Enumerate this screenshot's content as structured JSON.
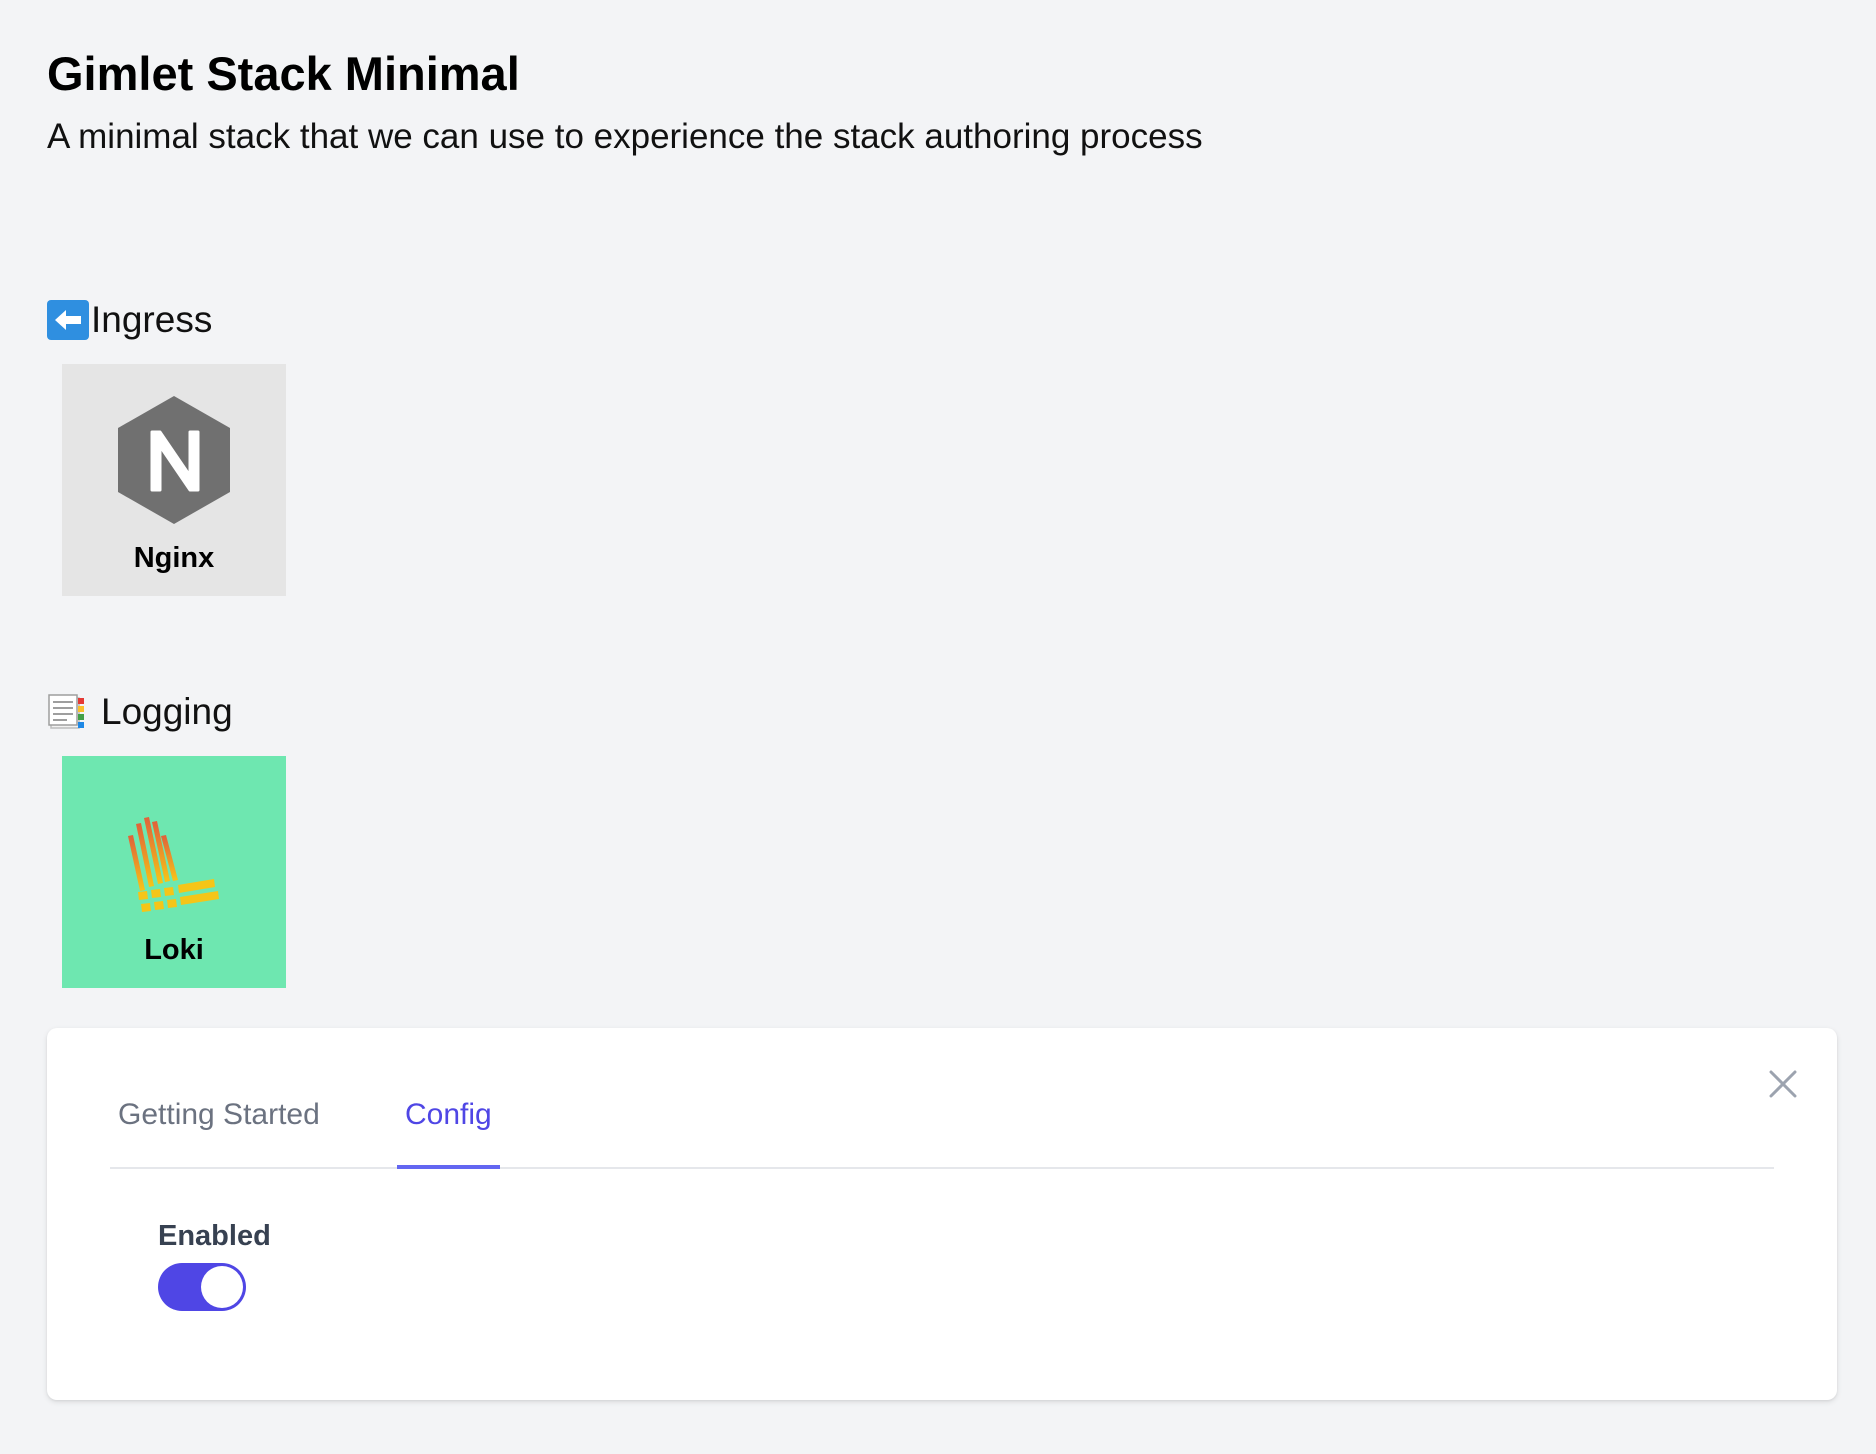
{
  "stack": {
    "title": "Gimlet Stack Minimal",
    "description": "A minimal stack that we can use to experience the stack authoring process"
  },
  "categories": [
    {
      "icon": "left-arrow-icon",
      "label": "Ingress",
      "components": [
        {
          "name": "Nginx",
          "logo": "nginx-logo",
          "tile_color": "#e5e5e5",
          "selected": false
        }
      ]
    },
    {
      "icon": "bookmark-tabs-icon",
      "label": "Logging",
      "components": [
        {
          "name": "Loki",
          "logo": "loki-logo",
          "tile_color": "#6ee7b0",
          "selected": true
        }
      ]
    }
  ],
  "config_panel": {
    "tabs": [
      {
        "label": "Getting Started",
        "active": false
      },
      {
        "label": "Config",
        "active": true
      }
    ],
    "close_icon": "close-icon",
    "fields": [
      {
        "label": "Enabled",
        "type": "toggle",
        "value": true
      }
    ]
  },
  "colors": {
    "accent": "#4f46e5",
    "page_background": "#f3f4f6",
    "selected_tile": "#6ee7b0"
  }
}
